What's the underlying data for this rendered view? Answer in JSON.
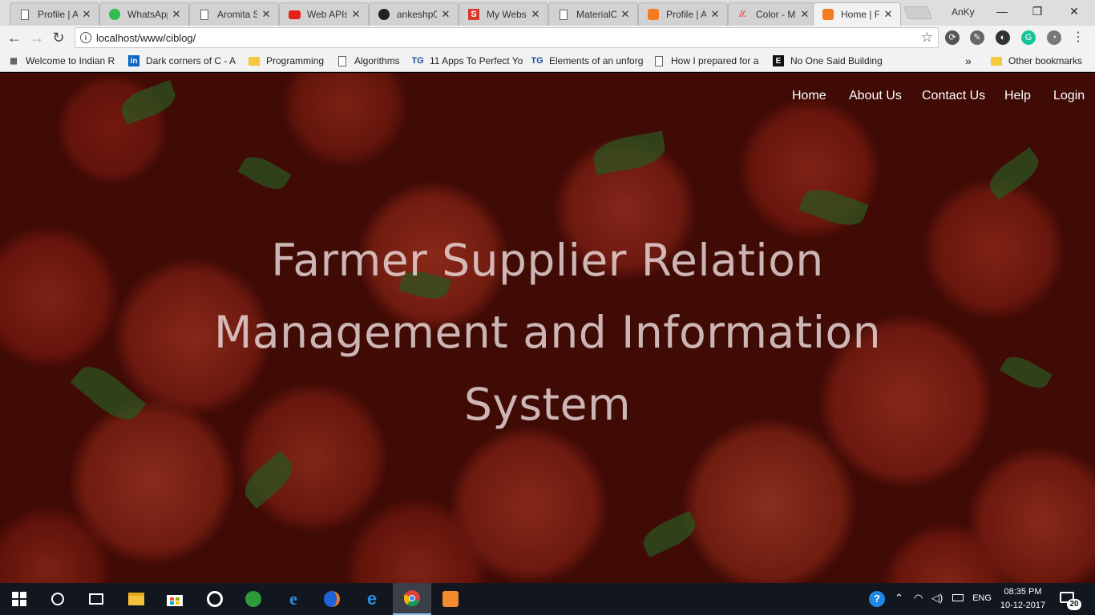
{
  "browser": {
    "tabs": [
      {
        "title": "Profile | A",
        "icon": "page-icon"
      },
      {
        "title": "WhatsApp",
        "icon": "whatsapp-icon"
      },
      {
        "title": "Aromita S",
        "icon": "page-icon"
      },
      {
        "title": "Web APIs",
        "icon": "youtube-icon"
      },
      {
        "title": "ankeshp0",
        "icon": "github-icon"
      },
      {
        "title": "My Webs",
        "icon": "s-icon"
      },
      {
        "title": "MaterialC",
        "icon": "page-icon"
      },
      {
        "title": "Profile | A",
        "icon": "xampp-icon"
      },
      {
        "title": "Color - M",
        "icon": "material-icon"
      },
      {
        "title": "Home | F",
        "icon": "xampp-icon"
      }
    ],
    "tab_close_glyph": "✕",
    "profile_name": "AnKy",
    "window_controls": {
      "minimize": "—",
      "maximize": "❐",
      "close": "✕"
    },
    "url": "localhost/www/ciblog/",
    "bookmarks": [
      {
        "label": "Welcome to Indian R",
        "icon": "indian-rail-icon"
      },
      {
        "label": "Dark corners of C - A",
        "icon": "linkedin-icon"
      },
      {
        "label": "Programming",
        "icon": "folder-icon"
      },
      {
        "label": "Algorithms",
        "icon": "page-icon"
      },
      {
        "label": "11 Apps To Perfect Yo",
        "icon": "tg-icon"
      },
      {
        "label": "Elements of an unforg",
        "icon": "tg-icon"
      },
      {
        "label": "How I prepared for a",
        "icon": "page-icon"
      },
      {
        "label": "No One Said Building",
        "icon": "e-icon"
      }
    ],
    "bookmarks_overflow": "»",
    "other_bookmarks": "Other bookmarks"
  },
  "site": {
    "nav": [
      "Home",
      "About Us",
      "Contact Us",
      "Help",
      "Login"
    ],
    "hero_title_lines": [
      "Farmer Supplier Relation",
      "Management and Information",
      "System"
    ]
  },
  "taskbar": {
    "language": "ENG",
    "time": "08:35 PM",
    "date": "10-12-2017",
    "notifications": "20"
  },
  "colors": {
    "chrome_bg": "#f2f2f2",
    "taskbar_bg": "#12171f",
    "hero_text": "#ebdcdc",
    "nav_text": "#ffffff"
  }
}
